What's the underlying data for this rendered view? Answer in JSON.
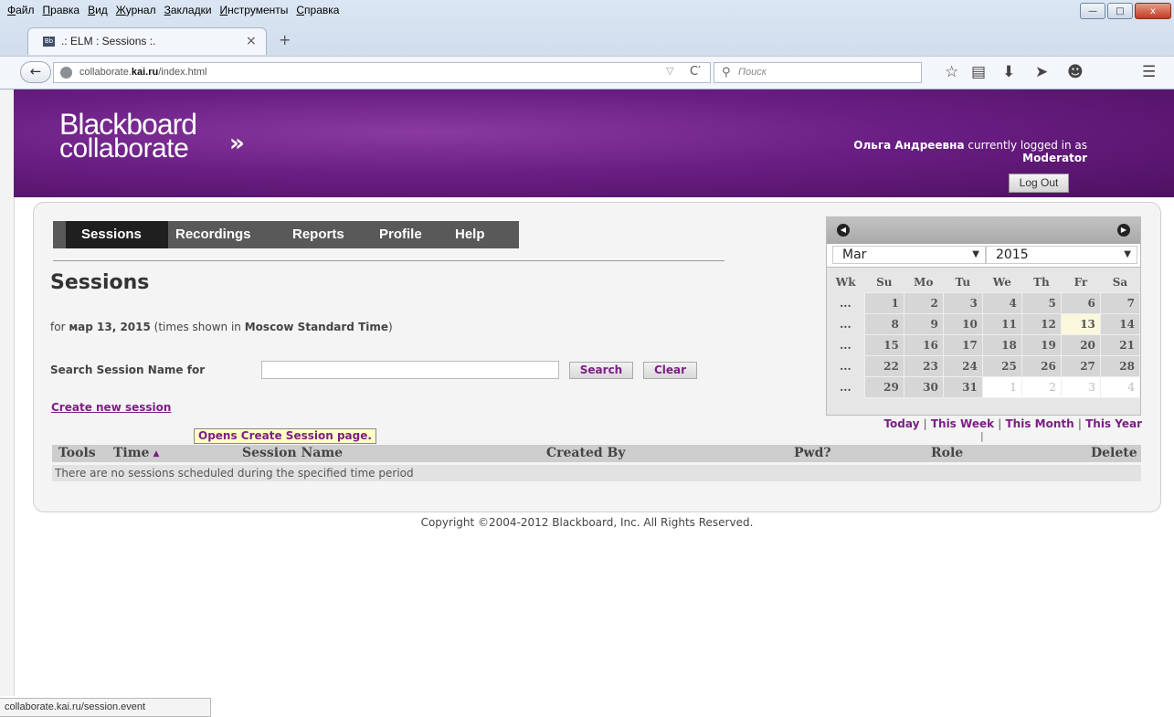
{
  "browser": {
    "menu": [
      "Файл",
      "Правка",
      "Вид",
      "Журнал",
      "Закладки",
      "Инструменты",
      "Справка"
    ],
    "window_buttons": {
      "minimize": "—",
      "maximize": "□",
      "close": "x"
    },
    "tab": {
      "favicon": "Bb",
      "title": ".: ELM : Sessions :.",
      "close": "×"
    },
    "new_tab": "+",
    "url": {
      "host_prefix": "collaborate.",
      "host_bold": "kai.ru",
      "path": "/index.html"
    },
    "search_placeholder": "Поиск",
    "status_url": "collaborate.kai.ru/session.event",
    "icons": [
      "back-arrow-icon",
      "globe-icon",
      "reload-icon",
      "search-icon",
      "bookmark-star-icon",
      "reading-list-icon",
      "download-icon",
      "share-icon",
      "chat-icon",
      "hamburger-menu-icon"
    ]
  },
  "header": {
    "logo_line1": "Blackboard",
    "logo_line2": "collaborate",
    "user_name": "Ольга Андреевна",
    "logged_in_text": "currently logged in as",
    "role": "Moderator",
    "logout_label": "Log Out",
    "brand_color": "#6a1e84"
  },
  "nav": {
    "tabs": [
      "Sessions",
      "Recordings",
      "Reports",
      "Profile",
      "Help"
    ],
    "active": "Sessions"
  },
  "main": {
    "title": "Sessions",
    "date_prefix": "for",
    "date": "мар 13, 2015",
    "tz_prefix": "(times shown in",
    "timezone": "Moscow Standard Time",
    "tz_suffix": ")",
    "search_label": "Search Session Name for",
    "search_value": "",
    "search_button": "Search",
    "clear_button": "Clear",
    "create_link": "Create new session",
    "tooltip": "Opens Create Session page.",
    "table": {
      "columns": [
        "Tools",
        "Time",
        "Session Name",
        "Created By",
        "Pwd?",
        "Role",
        "Delete"
      ],
      "empty_message": "There are no sessions scheduled during the specified time period"
    }
  },
  "calendar": {
    "month": "Mar",
    "year": "2015",
    "headers": [
      "Wk",
      "Su",
      "Mo",
      "Tu",
      "We",
      "Th",
      "Fr",
      "Sa"
    ],
    "week_marker": "...",
    "weeks": [
      [
        "1",
        "2",
        "3",
        "4",
        "5",
        "6",
        "7"
      ],
      [
        "8",
        "9",
        "10",
        "11",
        "12",
        "13",
        "14"
      ],
      [
        "15",
        "16",
        "17",
        "18",
        "19",
        "20",
        "21"
      ],
      [
        "22",
        "23",
        "24",
        "25",
        "26",
        "27",
        "28"
      ],
      [
        "29",
        "30",
        "31",
        "1",
        "2",
        "3",
        "4"
      ]
    ],
    "today": "13",
    "links": [
      "Today",
      "This Week",
      "This Month",
      "This Year"
    ],
    "link_separator": "|"
  },
  "footer": {
    "copyright": "Copyright ©2004-2012 Blackboard, Inc. All Rights Reserved."
  }
}
